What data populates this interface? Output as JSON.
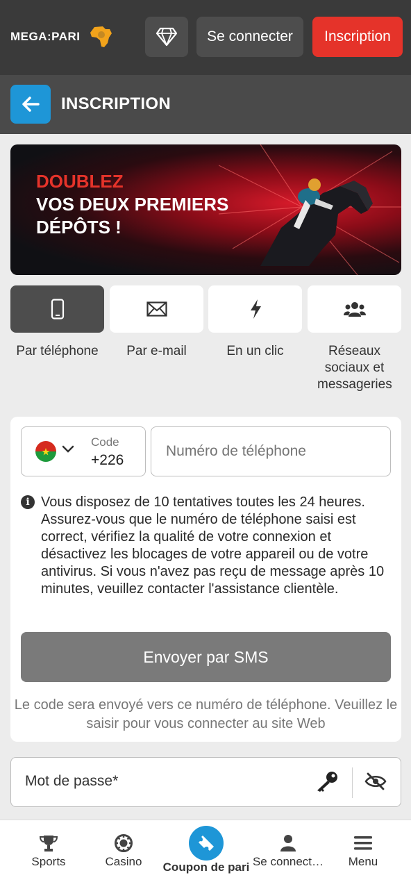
{
  "header": {
    "logo_text": "MEGA:PARI",
    "login_label": "Se connecter",
    "register_label": "Inscription",
    "brand_color": "#e5332a",
    "accent_color": "#1e96d7"
  },
  "titlebar": {
    "title": "INSCRIPTION"
  },
  "banner": {
    "line1": "DOUBLEZ",
    "line2": "VOS DEUX PREMIERS",
    "line3": "DÉPÔTS !"
  },
  "methods": [
    {
      "label": "Par téléphone",
      "icon": "phone-icon",
      "active": true
    },
    {
      "label": "Par e-mail",
      "icon": "envelope-icon",
      "active": false
    },
    {
      "label": "En un clic",
      "icon": "lightning-icon",
      "active": false
    },
    {
      "label": "Réseaux sociaux et messageries",
      "icon": "users-icon",
      "active": false
    }
  ],
  "form": {
    "code_label": "Code",
    "code_value": "+226",
    "phone_placeholder": "Numéro de téléphone",
    "info_text": "Vous disposez de 10 tentatives toutes les 24 heures. Assurez-vous que le numéro de téléphone saisi est correct, vérifiez la qualité de votre connexion et désactivez les blocages de votre appareil ou de votre antivirus. Si vous n'avez pas reçu de message après 10 minutes, veuillez contacter l'assistance clientèle.",
    "sms_button": "Envoyer par SMS",
    "sms_note": "Le code sera envoyé vers ce numéro de téléphone. Veuillez le saisir pour vous connecter au site Web",
    "password_placeholder": "Mot de passe*"
  },
  "bottom_nav": [
    {
      "label": "Sports",
      "icon": "trophy-icon"
    },
    {
      "label": "Casino",
      "icon": "poker-chip-icon"
    },
    {
      "label": "Coupon de pari",
      "icon": "ticket-icon"
    },
    {
      "label": "Se connect…",
      "icon": "person-icon"
    },
    {
      "label": "Menu",
      "icon": "hamburger-icon"
    }
  ]
}
